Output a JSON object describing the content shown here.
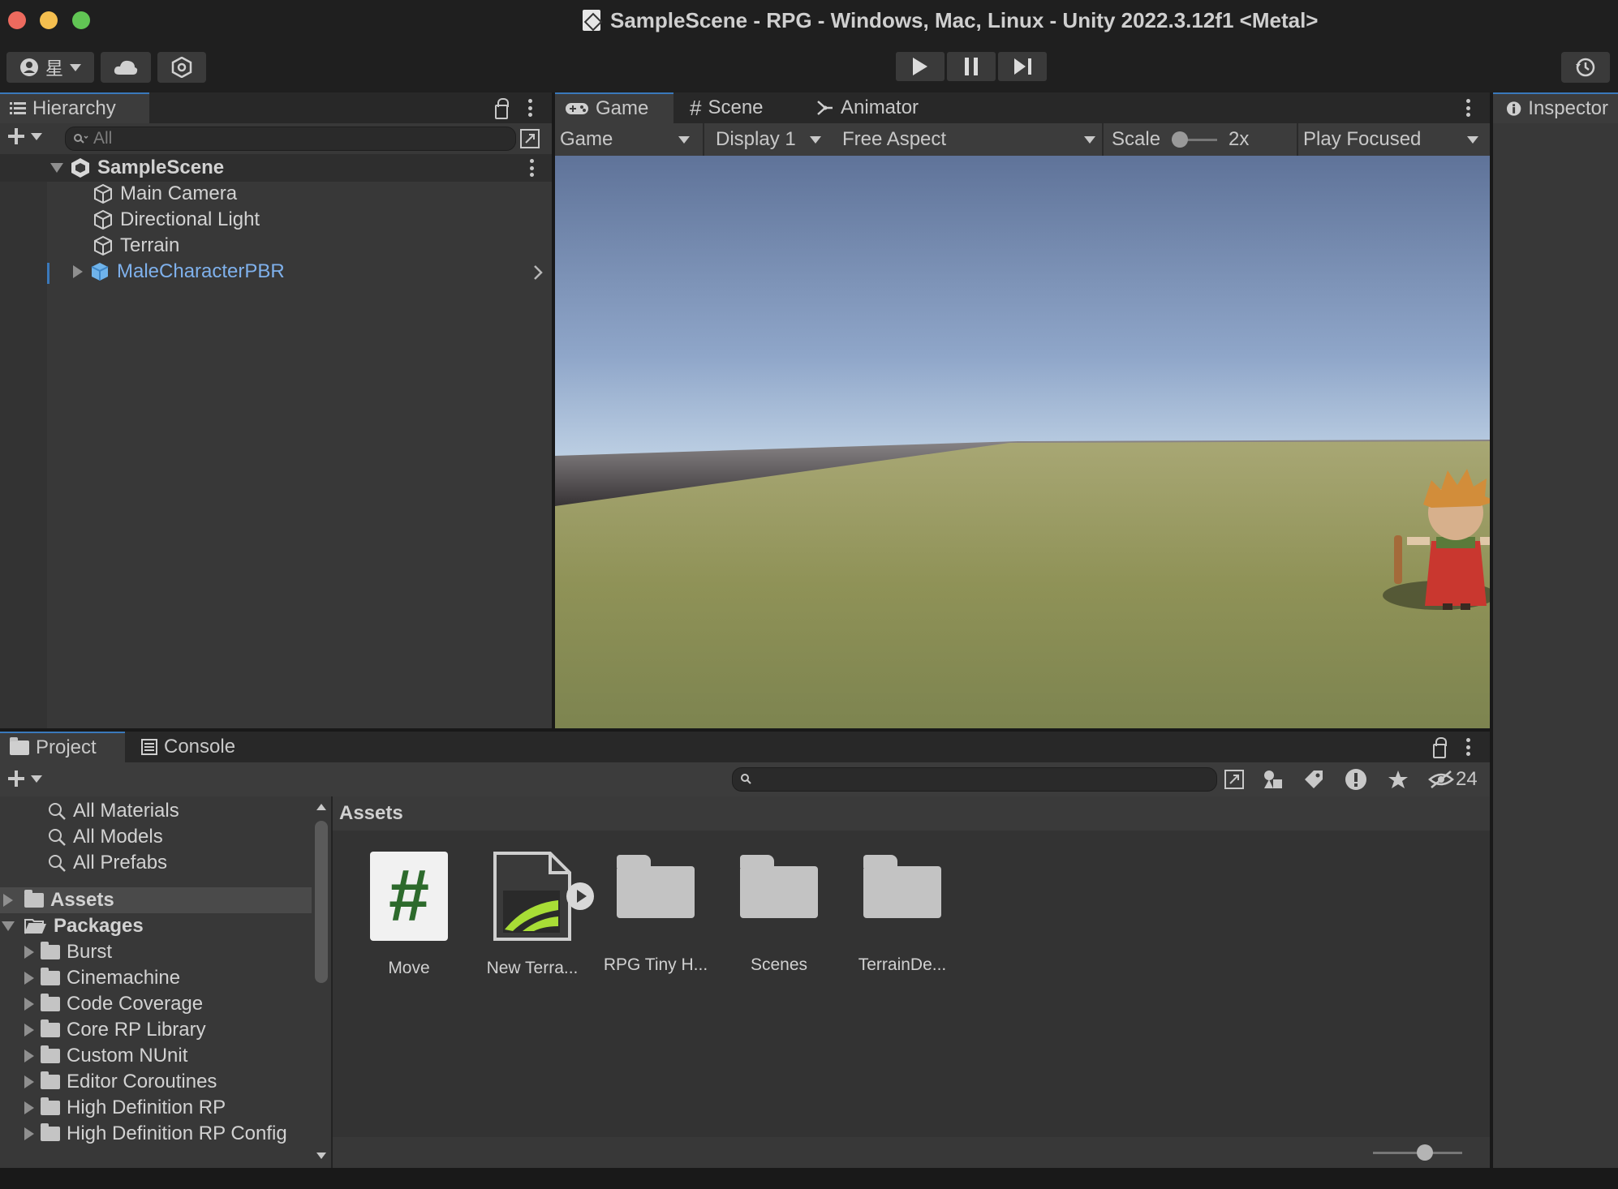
{
  "window": {
    "title": "SampleScene - RPG - Windows, Mac, Linux - Unity 2022.3.12f1 <Metal>"
  },
  "toolbar": {
    "account_label": "星"
  },
  "hierarchy": {
    "tab_label": "Hierarchy",
    "search_placeholder": "All",
    "scene_name": "SampleScene",
    "items": [
      "Main Camera",
      "Directional Light",
      "Terrain",
      "MaleCharacterPBR"
    ]
  },
  "game_view": {
    "tabs": [
      "Game",
      "Scene",
      "Animator"
    ],
    "mode_label": "Game",
    "display_label": "Display 1",
    "aspect_label": "Free Aspect",
    "scale_label": "Scale",
    "scale_value": "2x",
    "play_mode_label": "Play Focused"
  },
  "inspector": {
    "tab_label": "Inspector"
  },
  "project": {
    "tabs": [
      "Project",
      "Console"
    ],
    "hidden_count": "24",
    "favorites": [
      "All Materials",
      "All Models",
      "All Prefabs"
    ],
    "root_assets": "Assets",
    "root_packages": "Packages",
    "packages": [
      "Burst",
      "Cinemachine",
      "Code Coverage",
      "Core RP Library",
      "Custom NUnit",
      "Editor Coroutines",
      "High Definition RP",
      "High Definition RP Config"
    ],
    "breadcrumb": "Assets",
    "assets": [
      "Move",
      "New Terra...",
      "RPG Tiny H...",
      "Scenes",
      "TerrainDe..."
    ],
    "script_glyph": "#"
  },
  "colors": {
    "accent": "#3a79bb",
    "selected_text": "#7fb1ec",
    "panel": "#383838"
  }
}
